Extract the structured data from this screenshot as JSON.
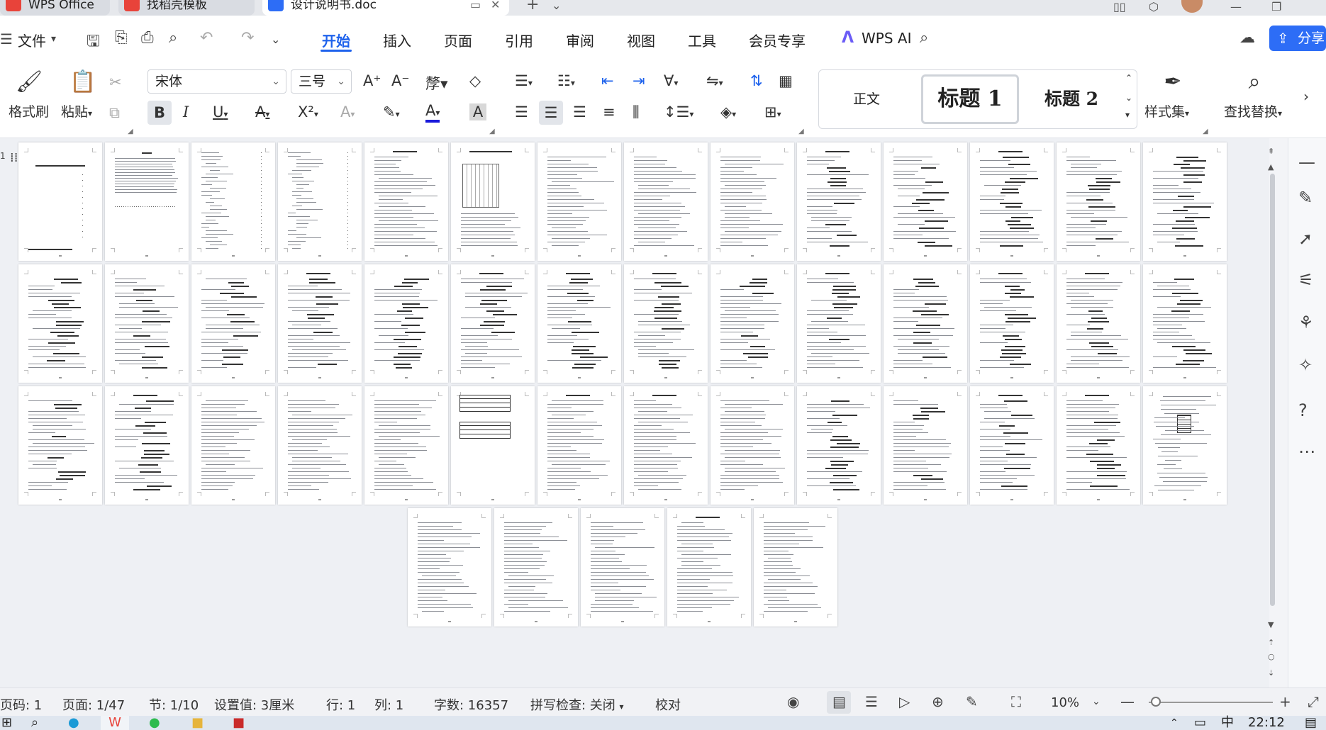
{
  "tabs": [
    {
      "label": "WPS Office",
      "logo_color": "#e8433a"
    },
    {
      "label": "找稻壳模板",
      "logo_color": "#e8433a"
    },
    {
      "label": "设计说明书.doc",
      "logo_color": "#2d6df6"
    }
  ],
  "tab_add": "+",
  "menu": {
    "file": "文件",
    "items": [
      "开始",
      "插入",
      "页面",
      "引用",
      "审阅",
      "视图",
      "工具",
      "会员专享"
    ],
    "active": "开始",
    "wps_ai": "WPS AI",
    "share": "分享"
  },
  "ribbon": {
    "format_painter": "格式刷",
    "paste": "粘贴",
    "font_name": "宋体",
    "font_size": "三号",
    "styles": [
      "正文",
      "标题 1",
      "标题 2"
    ],
    "style_set": "样式集",
    "find_replace": "查找替换"
  },
  "page_indicator": "1",
  "status": {
    "page_code": "页码: 1",
    "page": "页面: 1/47",
    "section": "节: 1/10",
    "setting": "设置值: 3厘米",
    "row": "行: 1",
    "col": "列: 1",
    "words": "字数: 16357",
    "spell": "拼写检查: 关闭",
    "proof": "校对",
    "zoom": "10%",
    "zoom_level": 0.1
  },
  "taskbar": {
    "clock": "22:12",
    "ime": "中"
  },
  "colors": {
    "accent": "#1e62ec",
    "share_bg": "#2d6df6",
    "wps_red": "#e8433a"
  },
  "icons": {
    "save": "save-icon",
    "print": "print-icon",
    "undo": "undo-icon",
    "redo": "redo-icon",
    "search": "search-icon",
    "cloud": "cloud-icon",
    "eye": "eye-icon",
    "globe": "globe-icon"
  }
}
